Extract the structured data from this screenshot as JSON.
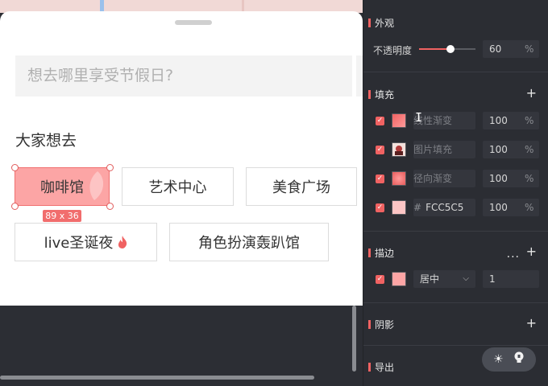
{
  "canvas": {
    "search": {
      "placeholder": "想去哪里享受节假日?"
    },
    "section_title": "大家想去",
    "tags": [
      {
        "label": "咖啡馆",
        "selected": true
      },
      {
        "label": "艺术中心"
      },
      {
        "label": "美食广场"
      },
      {
        "label": "live圣诞夜",
        "icon": "flame-icon"
      },
      {
        "label": "角色扮演轰趴馆"
      }
    ],
    "selection_size": "89 x 36"
  },
  "inspector": {
    "appearance": {
      "title": "外观",
      "opacity_label": "不透明度",
      "opacity_value": "60",
      "opacity_unit": "%",
      "opacity_fraction": 0.6
    },
    "fill": {
      "title": "填充",
      "add": "+",
      "rows": [
        {
          "name": "线性渐变",
          "value": "100",
          "unit": "%",
          "swatch": "#f06262",
          "kind": "linear-gradient"
        },
        {
          "name": "图片填充",
          "value": "100",
          "unit": "%",
          "swatch": "#a33838",
          "kind": "image"
        },
        {
          "name": "径向渐变",
          "value": "100",
          "unit": "%",
          "swatch": "#e55b5b",
          "kind": "radial-gradient"
        },
        {
          "hash": "#",
          "hex": "FCC5C5",
          "value": "100",
          "unit": "%",
          "swatch": "#fcc5c5",
          "kind": "solid"
        }
      ]
    },
    "stroke": {
      "title": "描边",
      "more": "···",
      "add": "+",
      "swatch": "#fca5a5",
      "position": "居中",
      "width": "1"
    },
    "shadow": {
      "title": "阴影",
      "add": "+"
    },
    "export": {
      "title": "导出"
    }
  },
  "colors": {
    "accent": "#f06262",
    "tag_selected": "#fca5a5",
    "panel_bg": "#2b2d33"
  }
}
